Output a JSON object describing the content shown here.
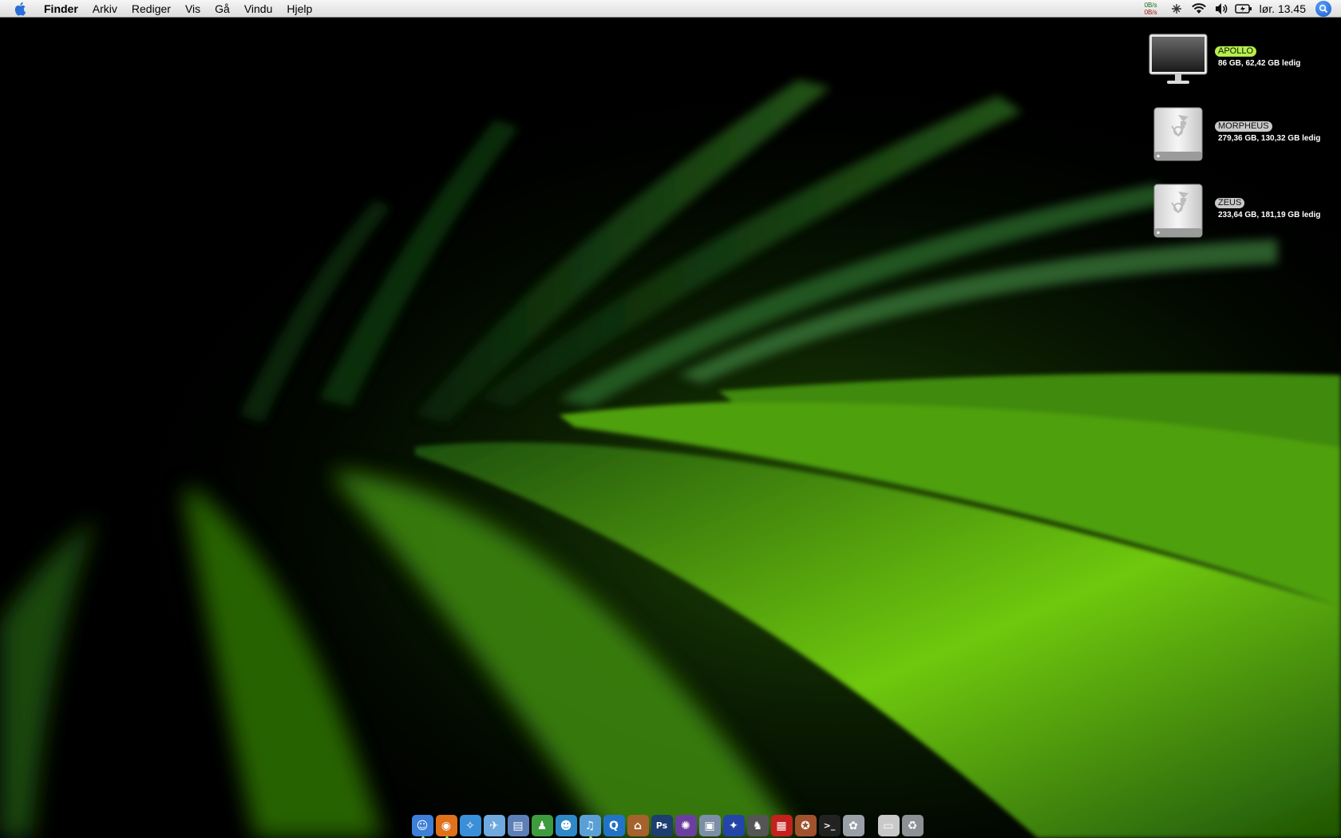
{
  "menubar": {
    "app_name": "Finder",
    "items": [
      "Arkiv",
      "Rediger",
      "Vis",
      "Gå",
      "Vindu",
      "Hjelp"
    ],
    "netspeed_up": "0B/s",
    "netspeed_down": "0B/s",
    "clock": "lør. 13.45",
    "status_icons": [
      "network-activity-icon",
      "wifi-icon",
      "volume-icon",
      "battery-icon",
      "spotlight-icon"
    ]
  },
  "desktop_drives": [
    {
      "name": "APOLLO",
      "info": "86 GB, 62,42 GB ledig",
      "icon": "computer-icon",
      "highlighted": true
    },
    {
      "name": "MORPHEUS",
      "info": "279,36 GB, 130,32 GB ledig",
      "icon": "firewire-drive-icon",
      "highlighted": false
    },
    {
      "name": "ZEUS",
      "info": "233,64 GB, 181,19 GB ledig",
      "icon": "firewire-drive-icon",
      "highlighted": false
    }
  ],
  "dock": {
    "items": [
      {
        "name": "finder-icon",
        "glyph": "☺",
        "color": "#3d7fd9",
        "running": true
      },
      {
        "name": "firefox-icon",
        "glyph": "◉",
        "color": "#e0701c",
        "running": true
      },
      {
        "name": "safari-icon",
        "glyph": "✧",
        "color": "#3a8fd8",
        "running": false
      },
      {
        "name": "mail-icon",
        "glyph": "✈",
        "color": "#6fa9de",
        "running": false
      },
      {
        "name": "preview-icon",
        "glyph": "▤",
        "color": "#5c7fb8",
        "running": false
      },
      {
        "name": "adium-icon",
        "glyph": "♟",
        "color": "#3e9b3e",
        "running": false
      },
      {
        "name": "messenger-icon",
        "glyph": "☻",
        "color": "#2f88c7",
        "running": false
      },
      {
        "name": "itunes-icon",
        "glyph": "♫",
        "color": "#5aa0d6",
        "running": true
      },
      {
        "name": "quicktime-icon",
        "glyph": "Q",
        "color": "#2273c8",
        "running": false
      },
      {
        "name": "iphoto-icon",
        "glyph": "⌂",
        "color": "#a5622c",
        "running": false
      },
      {
        "name": "photoshop-icon",
        "glyph": "Ps",
        "color": "#1d3e6e",
        "running": false
      },
      {
        "name": "aperture-icon",
        "glyph": "✺",
        "color": "#6b3fa0",
        "running": false
      },
      {
        "name": "transmit-icon",
        "glyph": "▣",
        "color": "#7d8fa6",
        "running": false
      },
      {
        "name": "bluetooth-icon",
        "glyph": "✦",
        "color": "#2445a8",
        "running": false
      },
      {
        "name": "cyberduck-icon",
        "glyph": "♞",
        "color": "#555555",
        "running": false
      },
      {
        "name": "front-row-icon",
        "glyph": "▦",
        "color": "#c4201e",
        "running": false
      },
      {
        "name": "dvd-player-icon",
        "glyph": "✪",
        "color": "#a0522d",
        "running": false
      },
      {
        "name": "terminal-icon",
        "glyph": ">_",
        "color": "#222222",
        "running": false
      },
      {
        "name": "system-preferences-icon",
        "glyph": "✿",
        "color": "#9aa0a8",
        "running": false
      },
      {
        "name": "downloads-stack-icon",
        "glyph": "▭",
        "color": "#c9c9c9",
        "running": false
      },
      {
        "name": "trash-icon",
        "glyph": "♻",
        "color": "#8d9196",
        "running": false
      }
    ]
  }
}
